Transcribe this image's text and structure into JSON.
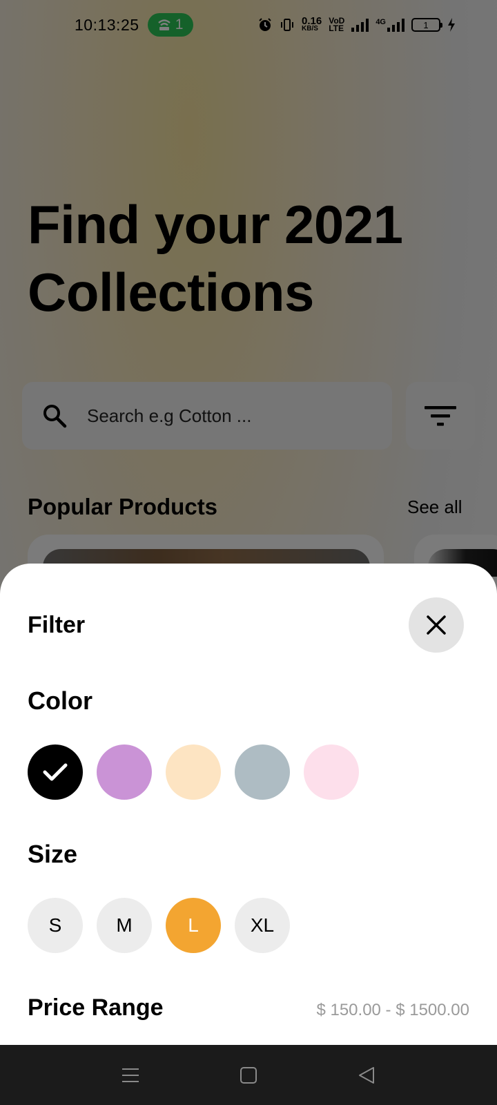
{
  "status_bar": {
    "time": "10:13:25",
    "hotspot_count": "1",
    "net_speed_value": "0.16",
    "net_speed_unit": "KB/S",
    "volte_top": "VoD",
    "volte_bottom": "LTE",
    "network_type": "4G",
    "battery_level": "1"
  },
  "hero": {
    "title_line1": "Find your 2021",
    "title_line2": "Collections"
  },
  "search": {
    "placeholder": "Search e.g Cotton ..."
  },
  "popular": {
    "title": "Popular Products",
    "see_all": "See all"
  },
  "filter_sheet": {
    "title": "Filter",
    "color_label": "Color",
    "colors": [
      {
        "hex": "#000000",
        "selected": true
      },
      {
        "hex": "#ca93d6",
        "selected": false
      },
      {
        "hex": "#fde4c2",
        "selected": false
      },
      {
        "hex": "#aebcc3",
        "selected": false
      },
      {
        "hex": "#fddfeb",
        "selected": false
      }
    ],
    "size_label": "Size",
    "sizes": [
      "S",
      "M",
      "L",
      "XL"
    ],
    "selected_size": "L",
    "price_label": "Price Range",
    "price_value": "$ 150.00 - $ 1500.00"
  },
  "colors": {
    "accent": "#f3a531",
    "hotspot_green": "#2bc255"
  },
  "icons": [
    "search-icon",
    "filter-icon",
    "close-icon",
    "check-icon",
    "menu-nav-icon",
    "home-nav-icon",
    "back-nav-icon"
  ]
}
